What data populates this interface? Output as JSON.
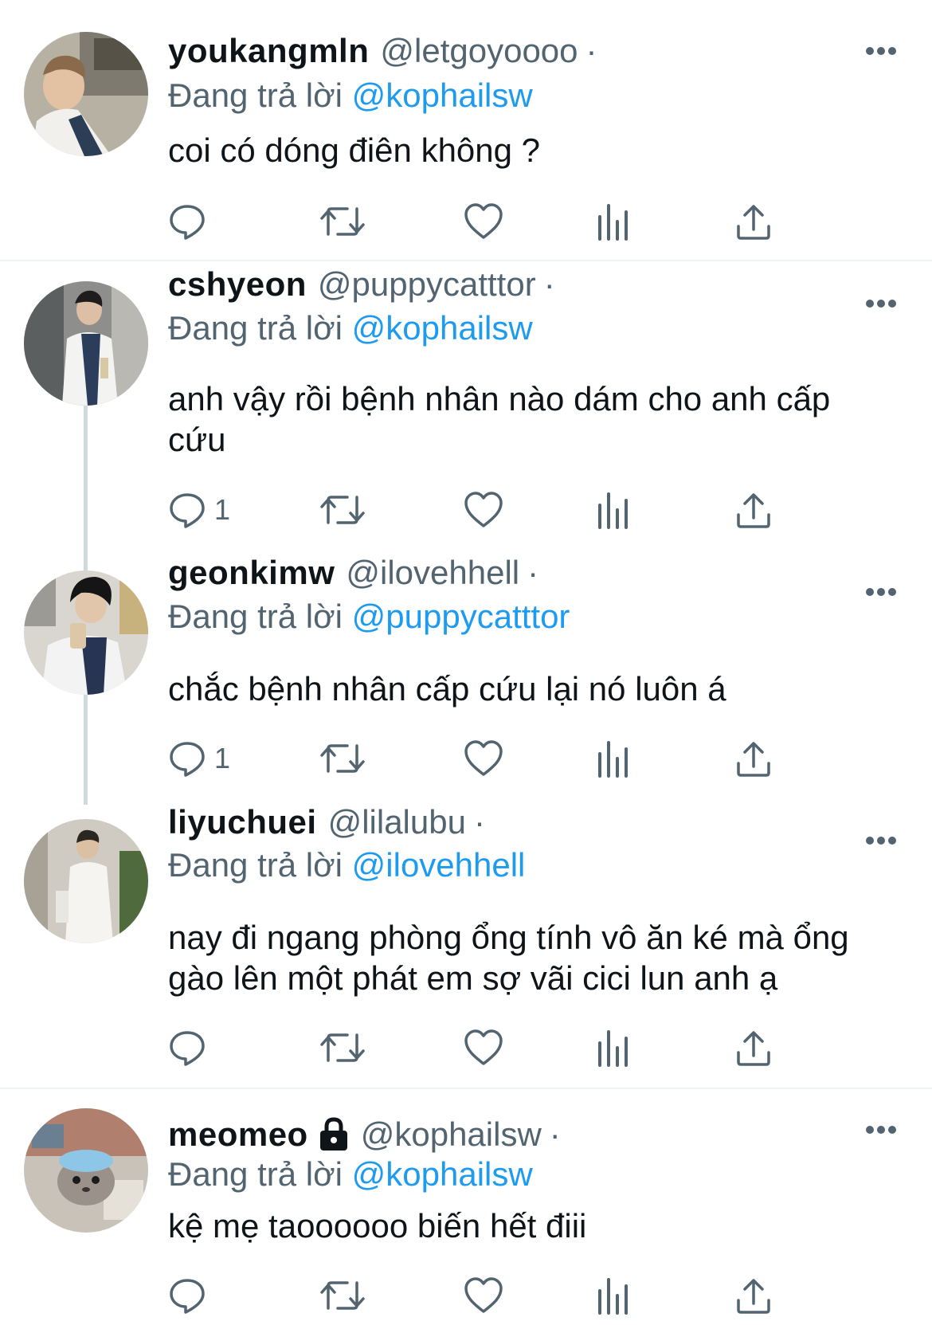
{
  "tweets": [
    {
      "display_name": "youkangmln",
      "handle": "@letgoyoooo",
      "separator": "·",
      "replying_label": "Đang trả lời",
      "replying_to": "@kophailsw",
      "text": "coi có dóng điên không ?",
      "reply_count": "",
      "avatar_icon": "avatar-photo"
    },
    {
      "display_name": "cshyeon",
      "handle": "@puppycatttor",
      "separator": "·",
      "replying_label": "Đang trả lời",
      "replying_to": "@kophailsw",
      "text": "anh vậy rồi bệnh nhân nào dám cho anh cấp cứu",
      "reply_count": "1",
      "avatar_icon": "avatar-photo"
    },
    {
      "display_name": "geonkimw",
      "handle": "@ilovehhell",
      "separator": "·",
      "replying_label": "Đang trả lời",
      "replying_to": "@puppycatttor",
      "text": "chắc bệnh nhân cấp cứu lại nó luôn á",
      "reply_count": "1",
      "avatar_icon": "avatar-photo"
    },
    {
      "display_name": "liyuchuei",
      "handle": "@lilalubu",
      "separator": "·",
      "replying_label": "Đang trả lời",
      "replying_to": "@ilovehhell",
      "text": "nay đi ngang phòng ổng tính vô ăn ké mà ổng gào lên một phát em sợ vãi cici lun anh ạ",
      "reply_count": "",
      "avatar_icon": "avatar-photo"
    },
    {
      "display_name": "meomeo",
      "handle": "@kophailsw",
      "separator": "·",
      "replying_label": "Đang trả lời",
      "replying_to": "@kophailsw",
      "text": "kệ mẹ taoooooo biến hết điii",
      "reply_count": "",
      "avatar_icon": "avatar-photo",
      "protected_icon": "lock-icon"
    }
  ],
  "icons": {
    "reply": "reply-icon",
    "retweet": "retweet-icon",
    "like": "heart-icon",
    "views": "views-icon",
    "share": "share-icon",
    "more": "more-icon"
  },
  "colors": {
    "link": "#1d9bf0",
    "secondary_text": "#536471",
    "primary_text": "#0f1419",
    "divider": "#eff3f4",
    "thread_line": "#cfd9de"
  }
}
